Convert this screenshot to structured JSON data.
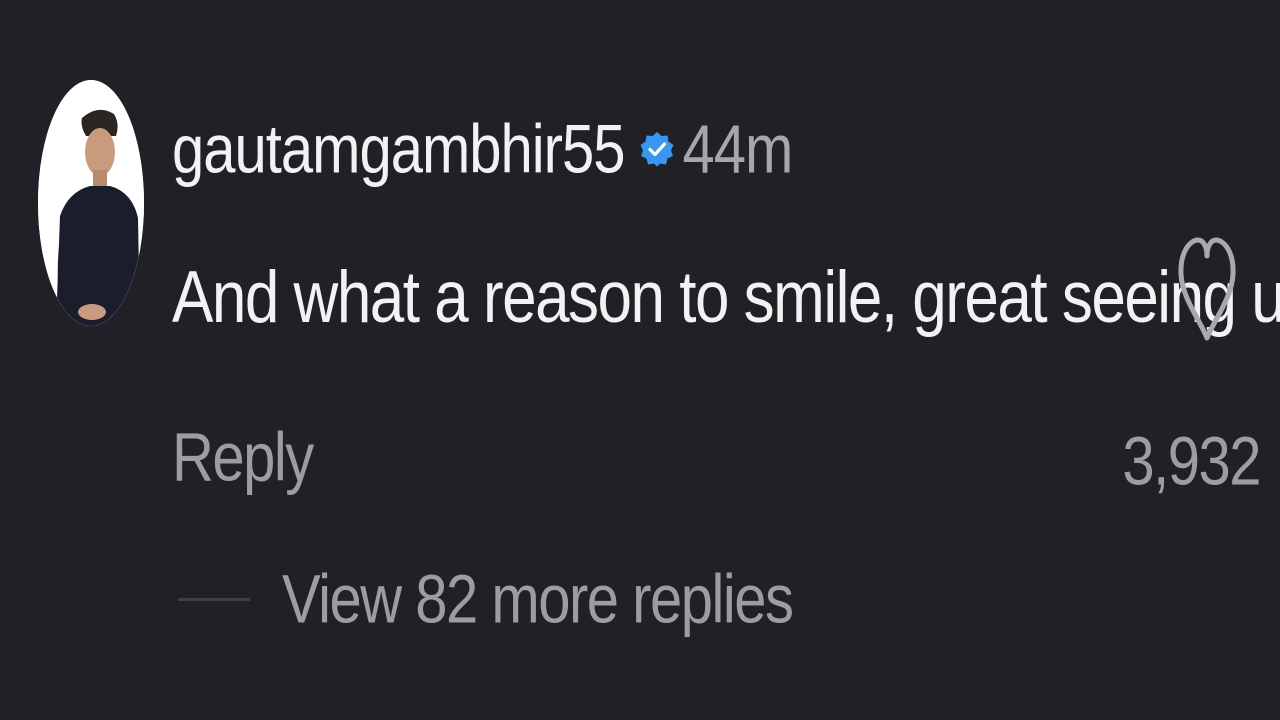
{
  "comment": {
    "avatar": "profile-photo",
    "username": "gautamgambhir55",
    "verified_icon": "verified-badge-icon",
    "time": "44m",
    "text": "And what a reason to smile, great seeing u!",
    "like_icon": "heart-outline-icon",
    "like_count": "3,932",
    "reply_label": "Reply",
    "more_replies_label": "View 82 more replies"
  },
  "colors": {
    "background": "#212027",
    "primary_text": "#f2f2f2",
    "secondary_text": "#9c9ca1",
    "verified_blue": "#3897f0"
  }
}
